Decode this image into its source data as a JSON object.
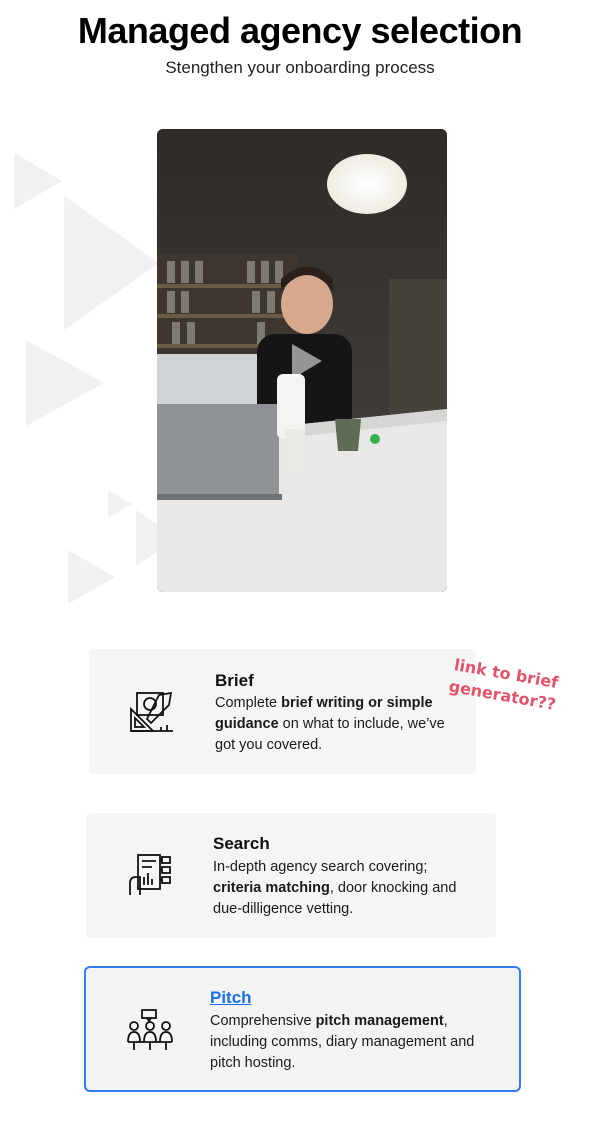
{
  "header": {
    "title": "Managed agency selection",
    "subtitle": "Stengthen your onboarding process"
  },
  "video": {
    "play_icon": "play-icon"
  },
  "cards": [
    {
      "title": "Brief",
      "icon": "ruler-pencil-icon",
      "desc_plain_1": "Complete ",
      "desc_bold": "brief writing or simple guidance",
      "desc_plain_2": " on what to include, we’ve got you covered."
    },
    {
      "title": "Search",
      "icon": "document-search-icon",
      "desc_plain_1": "In-depth agency search covering; ",
      "desc_bold": "criteria matching",
      "desc_plain_2": ", door knocking and due-dilligence vetting."
    },
    {
      "title": "Pitch",
      "icon": "team-meeting-icon",
      "desc_plain_1": "Comprehensive ",
      "desc_bold": "pitch management",
      "desc_plain_2": ", including comms, diary management and pitch hosting."
    }
  ],
  "annotation": {
    "text": "link to brief generator??"
  },
  "colors": {
    "accent": "#2f7cf0",
    "link": "#1a6fe6",
    "annotation": "#e0556a",
    "card_bg": "#f5f5f5"
  }
}
